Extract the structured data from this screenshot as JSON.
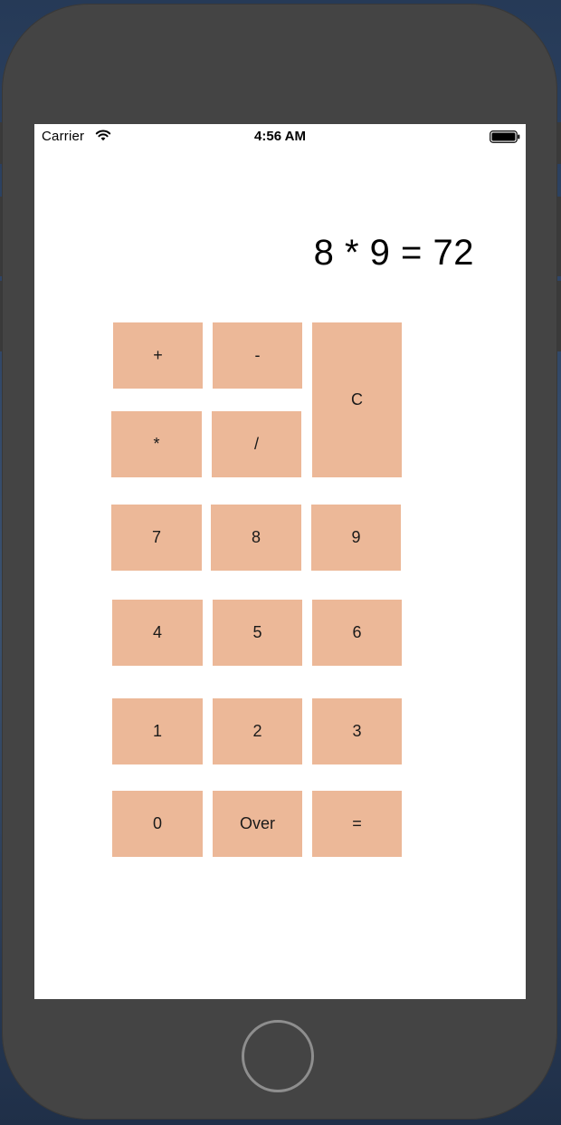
{
  "status_bar": {
    "carrier": "Carrier",
    "time": "4:56 AM",
    "wifi_icon": "wifi-icon",
    "battery_icon": "battery-full-icon"
  },
  "display": {
    "text": "8 * 9 = 72"
  },
  "keys": {
    "plus": "+",
    "minus": "-",
    "clear": "C",
    "multiply": "*",
    "divide": "/",
    "seven": "7",
    "eight": "8",
    "nine": "9",
    "four": "4",
    "five": "5",
    "six": "6",
    "one": "1",
    "two": "2",
    "three": "3",
    "zero": "0",
    "over": "Over",
    "equals": "="
  },
  "colors": {
    "key_background": "#ecb898",
    "device_body": "#444444",
    "screen_background": "#ffffff"
  }
}
